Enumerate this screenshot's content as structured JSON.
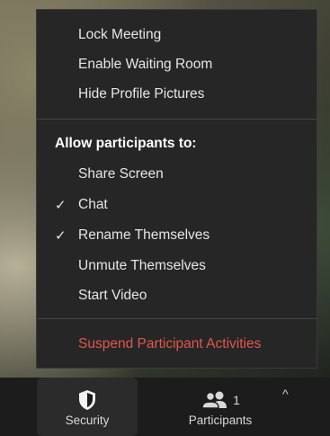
{
  "menu": {
    "top_items": [
      {
        "label": "Lock Meeting",
        "checked": false
      },
      {
        "label": "Enable Waiting Room",
        "checked": false
      },
      {
        "label": "Hide Profile Pictures",
        "checked": false
      }
    ],
    "section_header": "Allow participants to:",
    "participant_items": [
      {
        "label": "Share Screen",
        "checked": false
      },
      {
        "label": "Chat",
        "checked": true
      },
      {
        "label": "Rename Themselves",
        "checked": true
      },
      {
        "label": "Unmute Themselves",
        "checked": false
      },
      {
        "label": "Start Video",
        "checked": false
      }
    ],
    "danger_item": "Suspend Participant Activities",
    "check_glyph": "✓"
  },
  "toolbar": {
    "security_label": "Security",
    "participants_label": "Participants",
    "participants_count": "1",
    "caret_glyph": "^"
  },
  "colors": {
    "menu_bg": "#262626",
    "danger": "#e0574a",
    "toolbar_bg": "#1c1c1c"
  }
}
